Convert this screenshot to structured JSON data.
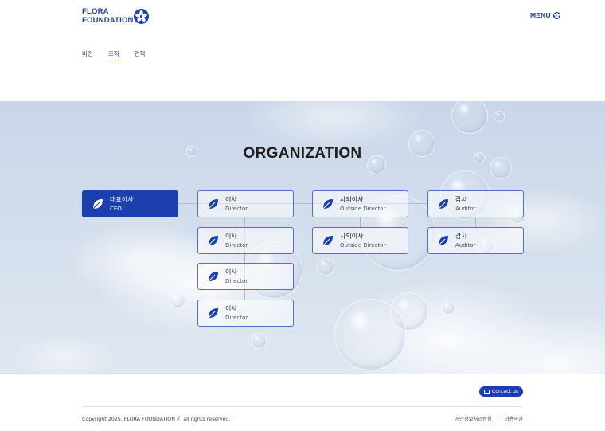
{
  "brand": {
    "line1": "FLORA",
    "line2": "FOUNDATION",
    "color": "#1c3fb0"
  },
  "header": {
    "menu_label": "MENU"
  },
  "tabs": [
    {
      "label": "비전",
      "active": false
    },
    {
      "label": "조직",
      "active": true
    },
    {
      "label": "연혁",
      "active": false
    }
  ],
  "section": {
    "title": "ORGANIZATION"
  },
  "org": {
    "ceo": {
      "title": "대표이사",
      "sub": "CEO"
    },
    "directors": [
      {
        "title": "이사",
        "sub": "Director"
      },
      {
        "title": "이사",
        "sub": "Director"
      },
      {
        "title": "이사",
        "sub": "Director"
      },
      {
        "title": "이사",
        "sub": "Director"
      }
    ],
    "outside_directors": [
      {
        "title": "사외이사",
        "sub": "Outside Director"
      },
      {
        "title": "사외이사",
        "sub": "Outside Director"
      }
    ],
    "auditors": [
      {
        "title": "감사",
        "sub": "Auditor"
      },
      {
        "title": "감사",
        "sub": "Auditor"
      }
    ]
  },
  "footer": {
    "contact_label": "Contact us",
    "copyright": "Copyright 2025. FLORA FOUNDATION ⓒ all rights reserved.",
    "links": [
      "개인정보처리방침",
      "이용약관"
    ]
  }
}
